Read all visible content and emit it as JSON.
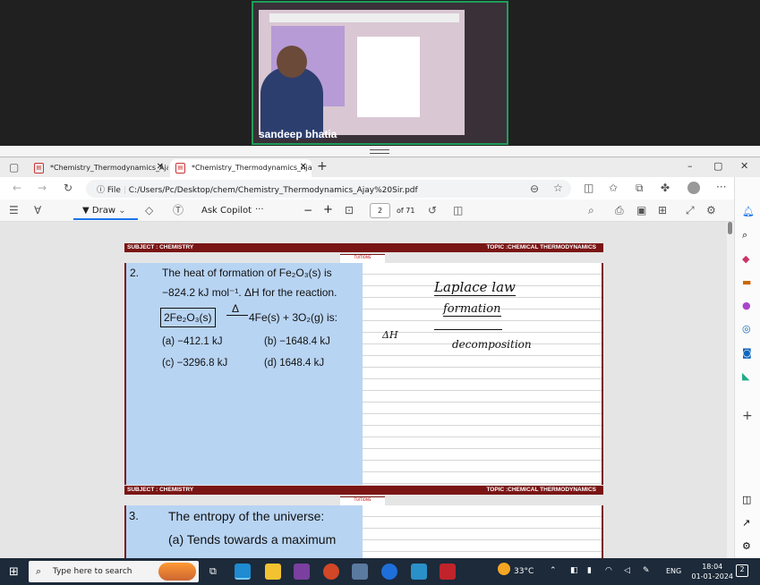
{
  "video": {
    "participant": "sandeep bhatia"
  },
  "browser": {
    "tabs": [
      {
        "label": "*Chemistry_Thermodynamics_Aja"
      },
      {
        "label": "*Chemistry_Thermodynamics_Aja"
      }
    ],
    "new_tab": "+",
    "address": {
      "prefix": "File",
      "url": "C:/Users/Pc/Desktop/chem/Chemistry_Thermodynamics_Ajay%20Sir.pdf"
    },
    "window": {
      "min": "–",
      "max": "▢",
      "close": "✕"
    }
  },
  "pdf_toolbar": {
    "draw": "Draw",
    "copilot": "Ask Copilot",
    "more": "···",
    "zoom_out": "−",
    "zoom_in": "+",
    "page": "2",
    "of": "of 71"
  },
  "page": {
    "subject": "SUBJECT : CHEMISTRY",
    "topic": "TOPIC :CHEMICAL THERMODYNAMICS",
    "logo": "TUITIONS",
    "q2": {
      "num": "2.",
      "line1": "The heat of formation of Fe₂O₃(s) is",
      "line2": "−824.2 kJ mol⁻¹. ΔH for the reaction.",
      "reaction_left": "2Fe₂O₃(s)",
      "arrow": "Δ",
      "reaction_right": "4Fe(s) + 3O₂(g) is:",
      "a": "(a) −412.1 kJ",
      "b": "(b) −1648.4 kJ",
      "c": "(c) −3296.8 kJ",
      "d": "(d) 1648.4 kJ"
    },
    "notes": {
      "title": "Laplace law",
      "formation": "formation",
      "dh": "ΔH",
      "decomposition": "decomposition"
    },
    "q3": {
      "num": "3.",
      "line1": "The entropy of the universe:",
      "line2": "(a) Tends towards a maximum"
    }
  },
  "taskbar": {
    "search": "Type here to search",
    "weather": "33°C",
    "lang": "ENG",
    "time": "18:04",
    "date": "01-01-2024",
    "notifications": "2"
  }
}
